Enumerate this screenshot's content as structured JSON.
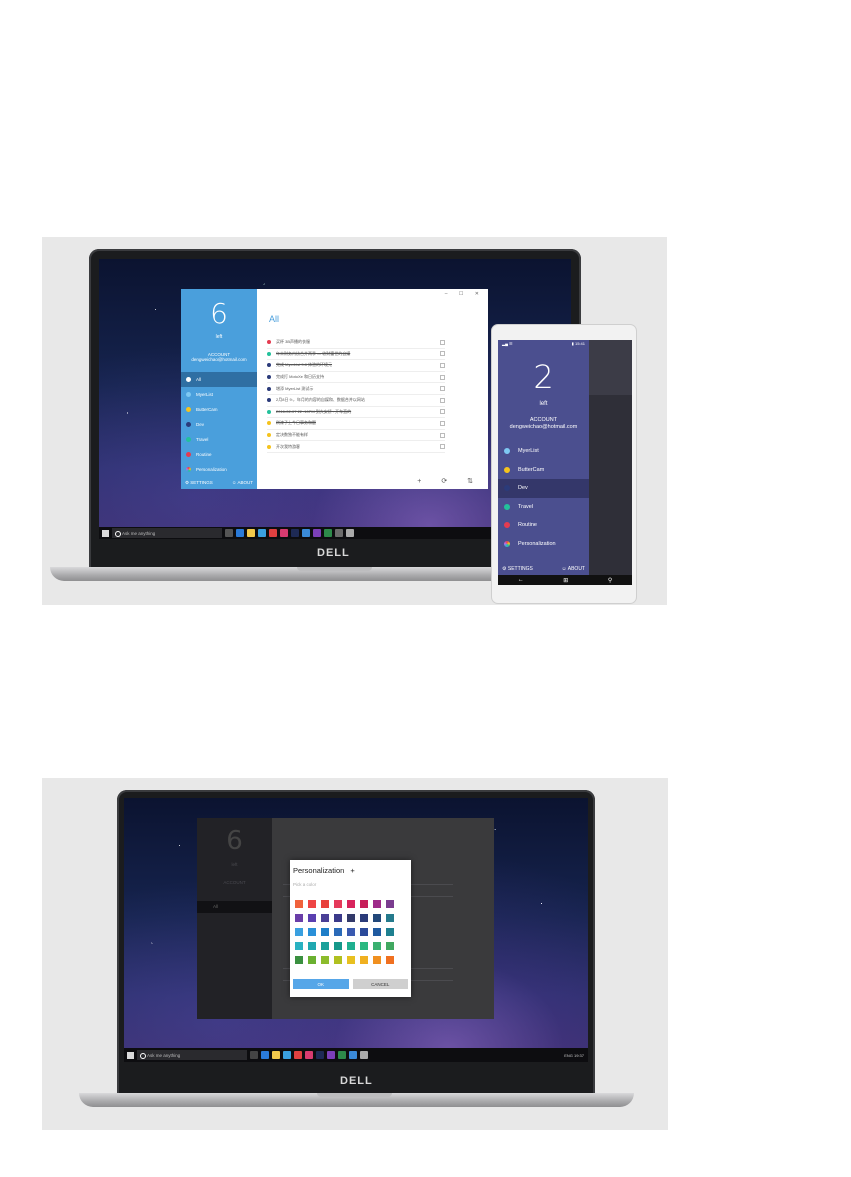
{
  "top": {
    "laptop": {
      "brand": "DELL",
      "taskbar": {
        "search_placeholder": "Ask me anything"
      },
      "app": {
        "count": "6",
        "count_label": "left",
        "account_label": "ACCOUNT",
        "account_email": "dengweichao@hotmail.com",
        "categories": [
          {
            "label": "All",
            "color": "#ffffff"
          },
          {
            "label": "MyerList",
            "color": "#7ec8f2"
          },
          {
            "label": "ButterCam",
            "color": "#f5c31d"
          },
          {
            "label": "Dev",
            "color": "#2b3b7a"
          },
          {
            "label": "Travel",
            "color": "#23c19b"
          },
          {
            "label": "Routine",
            "color": "#e53b50"
          },
          {
            "label": "Personalization",
            "color": "#c06ae0"
          }
        ],
        "settings_label": "SETTINGS",
        "about_label": "ABOUT",
        "main_title": "All",
        "win_controls": "– ☐ ✕",
        "todos": [
          {
            "text": "买杯 3B声播的衣服",
            "color": "#e53b50",
            "done": false
          },
          {
            "text": "年末财务内核合并两季 — 收财富世的自媒",
            "color": "#23c19b",
            "done": true
          },
          {
            "text": "完成 MyerList 9.8 体验的环境元",
            "color": "#2b3b7a",
            "done": true
          },
          {
            "text": "完成打 MotoXe 和日历支持",
            "color": "#2b3b7a",
            "done": false
          },
          {
            "text": "增添 MyerList 测试示",
            "color": "#2b3b7a",
            "done": false
          },
          {
            "text": "2月8日 9:，年月的内容的自媒和、数据合并以网站",
            "color": "#2b3b7a",
            "done": false
          },
          {
            "text": "2016-02-07 22 :10PM 到大安桥 . 开车直的",
            "color": "#23c19b",
            "done": true
          },
          {
            "text": "刷漆子上今日事务和题",
            "color": "#f5c31d",
            "done": true
          },
          {
            "text": "定决数独不能有样",
            "color": "#f5c31d",
            "done": false
          },
          {
            "text": "开次我特游客",
            "color": "#f5c31d",
            "done": false
          }
        ],
        "bar_icons": "+ ⟳ ⇅"
      }
    },
    "phone": {
      "status_left": "▂▄ ☰",
      "status_right": "▮ 15:41",
      "count": "2",
      "count_label": "left",
      "account_label": "ACCOUNT",
      "account_email": "dengweichao@hotmail.com",
      "categories": [
        {
          "label": "MyerList",
          "color": "#7ec8f2"
        },
        {
          "label": "ButterCam",
          "color": "#f5c31d"
        },
        {
          "label": "Dev",
          "color": "#2b3b7a"
        },
        {
          "label": "Travel",
          "color": "#23c19b"
        },
        {
          "label": "Routine",
          "color": "#e53b50"
        },
        {
          "label": "Personalization",
          "color": "#c06ae0"
        }
      ],
      "settings_label": "SETTINGS",
      "about_label": "ABOUT",
      "nav": {
        "back": "←",
        "home": "⊞",
        "search": "⚲"
      }
    }
  },
  "bottom": {
    "laptop": {
      "brand": "DELL",
      "taskbar": {
        "search_placeholder": "Ask me anything",
        "tray": "ENG  19:37"
      },
      "app": {
        "count": "6",
        "count_label": "left",
        "account_label": "ACCOUNT",
        "selected_label": "All"
      },
      "dialog": {
        "title": "Personalization",
        "add_icon": "+",
        "subtitle": "Pick a color",
        "ok_label": "OK",
        "cancel_label": "CANCEL",
        "colors": [
          "#f0623c",
          "#ee4545",
          "#e8403c",
          "#e5395a",
          "#d8245c",
          "#c71e5a",
          "#9e2b8a",
          "#7a3c8f",
          "#6a3ea8",
          "#5a3fb0",
          "#4a3f96",
          "#3b3a8a",
          "#333a6a",
          "#2b3b7a",
          "#22487a",
          "#257a8c",
          "#3aa0e0",
          "#2a90d8",
          "#1e7ec8",
          "#2a6ab8",
          "#3a5ab0",
          "#2b4a9a",
          "#1f5aa0",
          "#1e8090",
          "#2ab2c2",
          "#20a8b0",
          "#1aa09a",
          "#16988a",
          "#20b090",
          "#2ab880",
          "#3ab070",
          "#40a860",
          "#3a9040",
          "#6ab030",
          "#8cbc2c",
          "#b0c020",
          "#e8c020",
          "#f0b020",
          "#f09020",
          "#f07020"
        ]
      }
    }
  }
}
